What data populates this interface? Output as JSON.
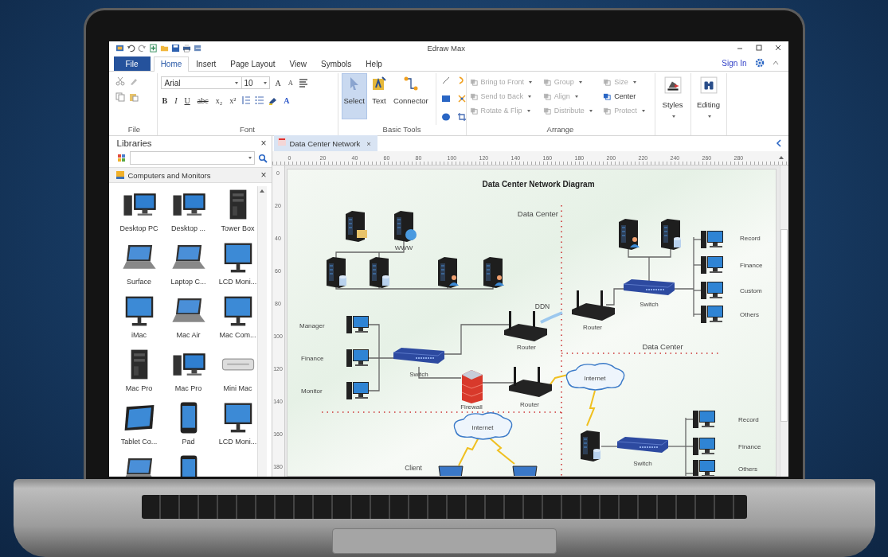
{
  "window": {
    "title": "Edraw Max"
  },
  "menu_tabs": [
    {
      "label": "File",
      "kind": "file",
      "selected": false
    },
    {
      "label": "Home",
      "kind": "tab",
      "selected": true
    },
    {
      "label": "Insert",
      "kind": "tab",
      "selected": false
    },
    {
      "label": "Page Layout",
      "kind": "tab",
      "selected": false
    },
    {
      "label": "View",
      "kind": "tab",
      "selected": false
    },
    {
      "label": "Symbols",
      "kind": "tab",
      "selected": false
    },
    {
      "label": "Help",
      "kind": "tab",
      "selected": false
    }
  ],
  "sign_in": "Sign In",
  "ribbon": {
    "file_group": {
      "label": "File"
    },
    "font_group": {
      "label": "Font",
      "font": "Arial",
      "size": "10",
      "grow": "A",
      "shrink": "A",
      "buttons": [
        "B",
        "I",
        "U",
        "abc",
        "x₂",
        "x²"
      ],
      "color_button": "A"
    },
    "basic_tools": {
      "label": "Basic Tools",
      "tools": [
        {
          "label": "Select",
          "kind": "select",
          "selected": true
        },
        {
          "label": "Text",
          "kind": "text",
          "selected": false
        },
        {
          "label": "Connector",
          "kind": "connector",
          "selected": false
        }
      ]
    },
    "arrange": {
      "label": "Arrange",
      "commands": [
        {
          "label": "Bring to Front",
          "disabled": true,
          "dropdown": true
        },
        {
          "label": "Send to Back",
          "disabled": true,
          "dropdown": true
        },
        {
          "label": "Rotate & Flip",
          "disabled": true,
          "dropdown": true
        },
        {
          "label": "Group",
          "disabled": true,
          "dropdown": true
        },
        {
          "label": "Align",
          "disabled": true,
          "dropdown": true
        },
        {
          "label": "Distribute",
          "disabled": true,
          "dropdown": true
        },
        {
          "label": "Size",
          "disabled": true,
          "dropdown": true
        },
        {
          "label": "Center",
          "disabled": false,
          "dropdown": false
        },
        {
          "label": "Protect",
          "disabled": true,
          "dropdown": true
        }
      ]
    },
    "large_buttons": [
      {
        "label": "Styles",
        "kind": "styles"
      },
      {
        "label": "Editing",
        "kind": "editing"
      }
    ]
  },
  "libraries": {
    "title": "Libraries",
    "close": "×",
    "category": {
      "label": "Computers and Monitors",
      "close": "×"
    },
    "items": [
      {
        "label": "Desktop PC",
        "kind": "desktop"
      },
      {
        "label": "Desktop ...",
        "kind": "desktop"
      },
      {
        "label": "Tower Box",
        "kind": "tower"
      },
      {
        "label": "Surface",
        "kind": "laptop"
      },
      {
        "label": "Laptop C...",
        "kind": "laptop"
      },
      {
        "label": "LCD Moni...",
        "kind": "monitor"
      },
      {
        "label": "iMac",
        "kind": "monitor"
      },
      {
        "label": "Mac Air",
        "kind": "laptop"
      },
      {
        "label": "Mac Com...",
        "kind": "monitor"
      },
      {
        "label": "Mac Pro",
        "kind": "tower"
      },
      {
        "label": "Mac Pro",
        "kind": "desktop"
      },
      {
        "label": "Mini Mac",
        "kind": "mini"
      },
      {
        "label": "Tablet Co...",
        "kind": "tablet"
      },
      {
        "label": "Pad",
        "kind": "pad"
      },
      {
        "label": "LCD Moni...",
        "kind": "monitor"
      },
      {
        "kind": "laptop"
      },
      {
        "kind": "pad"
      }
    ]
  },
  "document_tab": {
    "label": "Data Center Network",
    "close": "×"
  },
  "ruler": {
    "horizontal": [
      "0",
      "20",
      "40",
      "60",
      "80",
      "100",
      "120",
      "140",
      "160",
      "180",
      "200",
      "220",
      "240",
      "260",
      "280"
    ],
    "vertical": [
      "0",
      "20",
      "40",
      "60",
      "80",
      "100",
      "120",
      "140",
      "160",
      "180"
    ]
  },
  "diagram": {
    "title": "Data Center Network Diagram",
    "texts": [
      {
        "kind": "zone",
        "text": "Data Center"
      },
      {
        "kind": "zone",
        "text": "Data Center"
      },
      {
        "kind": "link",
        "text": "DDN"
      },
      {
        "kind": "group",
        "text": "Client"
      }
    ],
    "nodes": [
      {
        "kind": "file_server"
      },
      {
        "kind": "web_server",
        "label": "WWW"
      },
      {
        "kind": "db_server"
      },
      {
        "kind": "db_server"
      },
      {
        "kind": "user_server"
      },
      {
        "kind": "user_server"
      },
      {
        "kind": "pc",
        "label": "Manager"
      },
      {
        "kind": "pc",
        "label": "Finance"
      },
      {
        "kind": "pc",
        "label": "Monitor"
      },
      {
        "kind": "switch",
        "label": "Switch"
      },
      {
        "kind": "router",
        "label": "Router"
      },
      {
        "kind": "firewall",
        "label": "Firewall"
      },
      {
        "kind": "router",
        "label": "Router"
      },
      {
        "kind": "cloud",
        "label": "Internet"
      },
      {
        "kind": "laptop"
      },
      {
        "kind": "laptop"
      },
      {
        "kind": "user_server"
      },
      {
        "kind": "db_server"
      },
      {
        "kind": "switch",
        "label": "Switch"
      },
      {
        "kind": "router",
        "label": "Router"
      },
      {
        "kind": "pc",
        "label": "Record"
      },
      {
        "kind": "pc",
        "label": "Finance"
      },
      {
        "kind": "pc",
        "label": "Custom"
      },
      {
        "kind": "pc",
        "label": "Others"
      },
      {
        "kind": "cloud",
        "label": "Internet"
      },
      {
        "kind": "db_server"
      },
      {
        "kind": "switch",
        "label": "Switch"
      },
      {
        "kind": "pc",
        "label": "Record"
      },
      {
        "kind": "pc",
        "label": "Finance"
      },
      {
        "kind": "pc",
        "label": "Others"
      }
    ]
  }
}
